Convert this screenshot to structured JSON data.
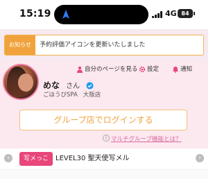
{
  "status_bar": {
    "time": "15:19",
    "network": "4G",
    "battery": "84"
  },
  "notice": {
    "tag": "お知らせ",
    "text": "予約評価アイコンを更新いたしました"
  },
  "header_links": {
    "my_page": "自分のページを見る",
    "settings": "設定",
    "notifications": "通知"
  },
  "profile": {
    "name": "めな",
    "honorific": "さん",
    "shop": "ごほうびSPA",
    "area": "大阪店",
    "verified": true
  },
  "group_login_label": "グループ店でログインする",
  "multi_group_link": "マルチグループ機能とは？",
  "slider": {
    "tag": "写メっこ",
    "text": "LEVEL30 聖天使写メル"
  },
  "colors": {
    "accent_pink": "#e8477a",
    "accent_orange": "#f0a33c",
    "panel_pink": "#fce8ef",
    "verified_blue": "#1d9bf0"
  }
}
